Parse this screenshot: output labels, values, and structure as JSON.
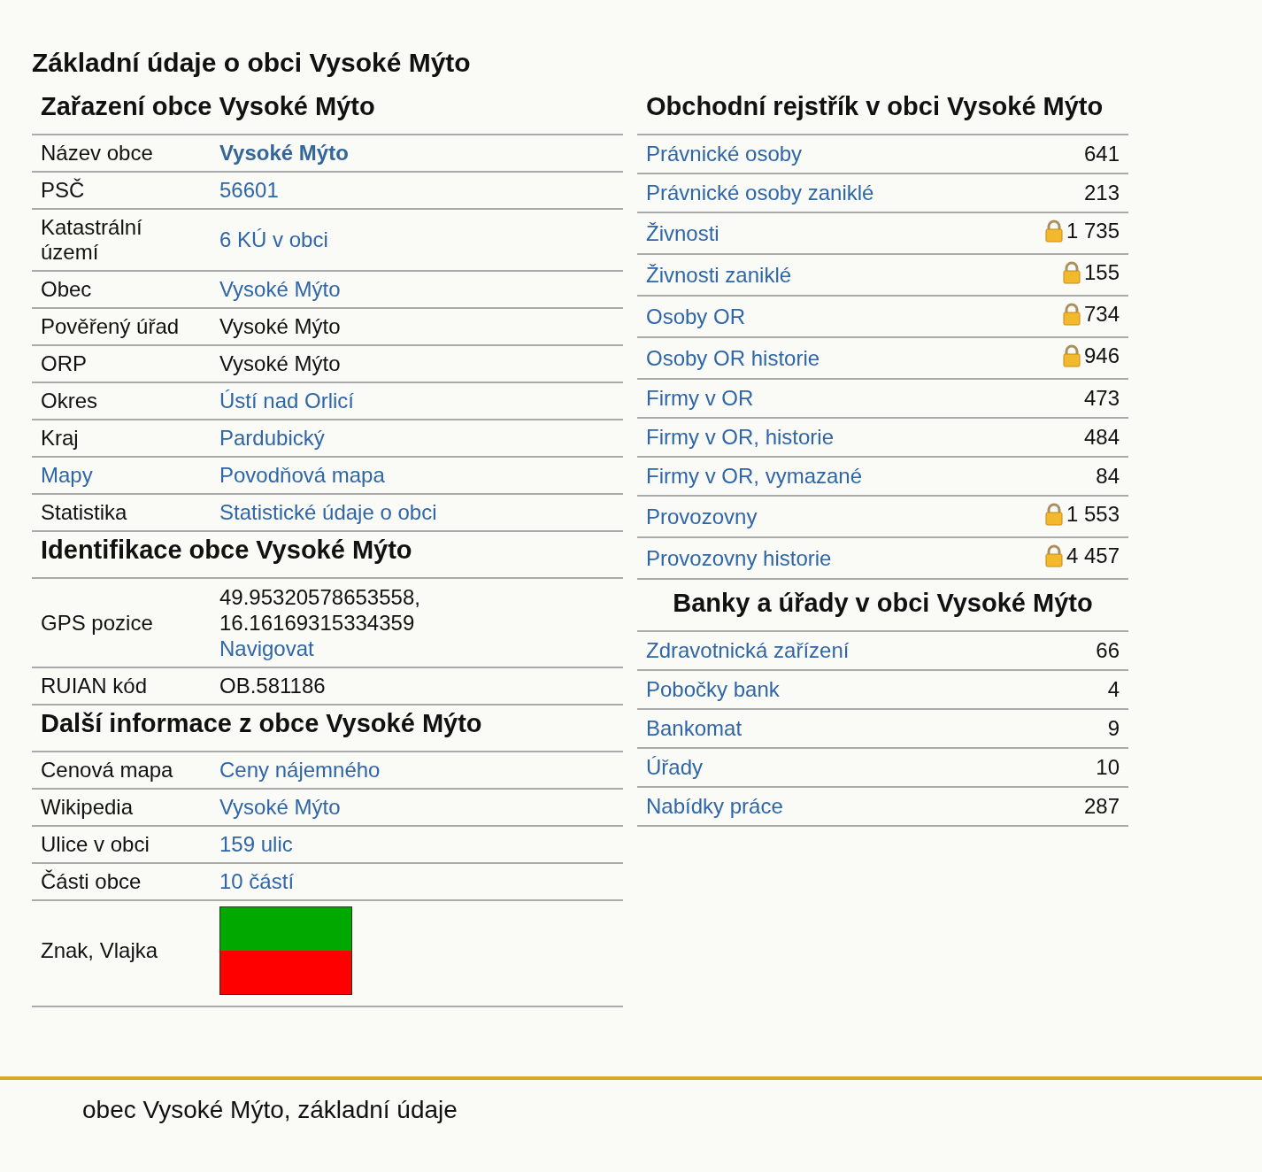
{
  "page_title": "Základní údaje o obci Vysoké Mýto",
  "left_sections": [
    {
      "heading": "Zařazení obce Vysoké Mýto",
      "rows": [
        {
          "label": "Název obce",
          "label_link": false,
          "kind": "link_bold",
          "lines": [
            "Vysoké Mýto"
          ]
        },
        {
          "label": "PSČ",
          "label_link": false,
          "kind": "link",
          "lines": [
            "56601"
          ]
        },
        {
          "label": "Katastrální území",
          "label_link": false,
          "kind": "link",
          "lines": [
            "6 KÚ v obci"
          ]
        },
        {
          "label": "Obec",
          "label_link": false,
          "kind": "link",
          "lines": [
            "Vysoké Mýto"
          ]
        },
        {
          "label": "Pověřený úřad",
          "label_link": false,
          "kind": "text",
          "lines": [
            "Vysoké Mýto"
          ]
        },
        {
          "label": "ORP",
          "label_link": false,
          "kind": "text",
          "lines": [
            "Vysoké Mýto"
          ]
        },
        {
          "label": "Okres",
          "label_link": false,
          "kind": "link",
          "lines": [
            "Ústí nad Orlicí"
          ]
        },
        {
          "label": "Kraj",
          "label_link": false,
          "kind": "link",
          "lines": [
            "Pardubický"
          ]
        },
        {
          "label": "Mapy",
          "label_link": true,
          "kind": "link",
          "lines": [
            "Povodňová mapa"
          ]
        },
        {
          "label": "Statistika",
          "label_link": false,
          "kind": "link",
          "lines": [
            "Statistické údaje o obci"
          ]
        }
      ]
    },
    {
      "heading": "Identifikace obce Vysoké Mýto",
      "rows": [
        {
          "label": "GPS pozice",
          "label_link": false,
          "kind": "gps",
          "lines": [
            "49.95320578653558,",
            "16.16169315334359",
            "Navigovat"
          ]
        },
        {
          "label": "RUIAN kód",
          "label_link": false,
          "kind": "text",
          "lines": [
            "OB.581186"
          ]
        }
      ]
    },
    {
      "heading": "Další informace z obce Vysoké Mýto",
      "rows": [
        {
          "label": "Cenová mapa",
          "label_link": false,
          "kind": "link",
          "lines": [
            "Ceny nájemného"
          ]
        },
        {
          "label": "Wikipedia",
          "label_link": false,
          "kind": "link",
          "lines": [
            "Vysoké Mýto"
          ]
        },
        {
          "label": "Ulice v obci",
          "label_link": false,
          "kind": "link",
          "lines": [
            "159 ulic"
          ]
        },
        {
          "label": "Části obce",
          "label_link": false,
          "kind": "link",
          "lines": [
            "10 částí"
          ]
        },
        {
          "label": "Znak, Vlajka",
          "label_link": false,
          "kind": "flag",
          "lines": []
        }
      ]
    }
  ],
  "right_sections": [
    {
      "heading": "Obchodní rejstřík v obci Vysoké Mýto",
      "rows": [
        {
          "label": "Právnické osoby",
          "value": "641",
          "locked": false
        },
        {
          "label": "Právnické osoby zaniklé",
          "value": "213",
          "locked": false
        },
        {
          "label": "Živnosti",
          "value": "1 735",
          "locked": true
        },
        {
          "label": "Živnosti zaniklé",
          "value": "155",
          "locked": true
        },
        {
          "label": "Osoby OR",
          "value": "734",
          "locked": true
        },
        {
          "label": "Osoby OR historie",
          "value": "946",
          "locked": true
        },
        {
          "label": "Firmy v OR",
          "value": "473",
          "locked": false
        },
        {
          "label": "Firmy v OR, historie",
          "value": "484",
          "locked": false
        },
        {
          "label": "Firmy v OR, vymazané",
          "value": "84",
          "locked": false
        },
        {
          "label": "Provozovny",
          "value": "1 553",
          "locked": true
        },
        {
          "label": "Provozovny historie",
          "value": "4 457",
          "locked": true
        }
      ]
    },
    {
      "heading": "Banky a úřady v obci Vysoké Mýto",
      "rows": [
        {
          "label": "Zdravotnická zařízení",
          "value": "66",
          "locked": false
        },
        {
          "label": "Pobočky bank",
          "value": "4",
          "locked": false
        },
        {
          "label": "Bankomat",
          "value": "9",
          "locked": false
        },
        {
          "label": "Úřady",
          "value": "10",
          "locked": false
        },
        {
          "label": "Nabídky práce",
          "value": "287",
          "locked": false
        }
      ]
    }
  ],
  "footer": "obec Vysoké Mýto, základní údaje"
}
